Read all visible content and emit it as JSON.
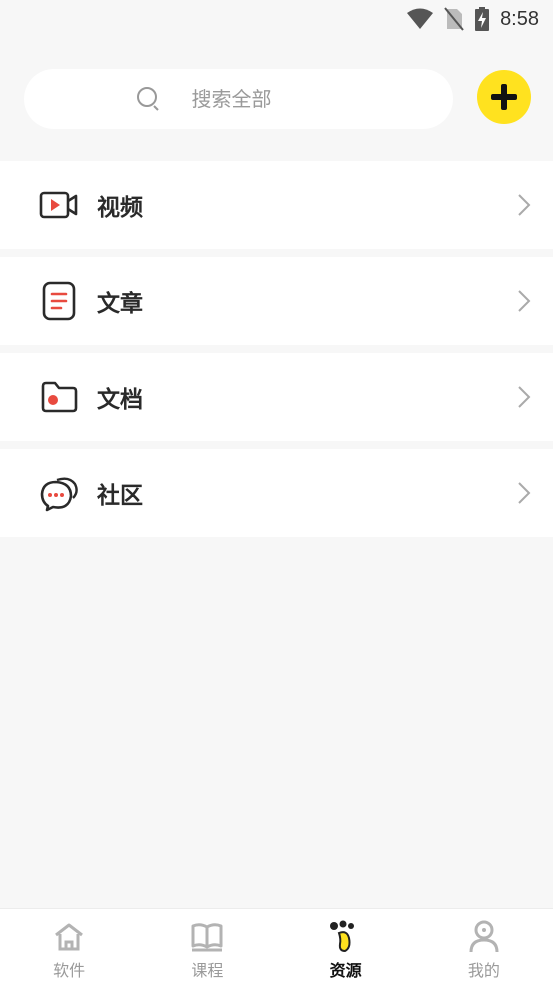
{
  "status_bar": {
    "time": "8:58"
  },
  "search": {
    "placeholder": "搜索全部"
  },
  "menu": {
    "items": [
      {
        "label": "视频",
        "icon": "video-camera-icon"
      },
      {
        "label": "文章",
        "icon": "article-icon"
      },
      {
        "label": "文档",
        "icon": "folder-icon"
      },
      {
        "label": "社区",
        "icon": "chat-bubble-icon"
      }
    ]
  },
  "nav": {
    "tabs": [
      {
        "label": "软件",
        "icon": "house-icon"
      },
      {
        "label": "课程",
        "icon": "open-book-icon"
      },
      {
        "label": "资源",
        "icon": "paw-icon",
        "active": true
      },
      {
        "label": "我的",
        "icon": "person-icon"
      }
    ]
  },
  "colors": {
    "accent": "#ffe21f",
    "icon_red": "#e84a3f",
    "background": "#f7f7f7"
  }
}
